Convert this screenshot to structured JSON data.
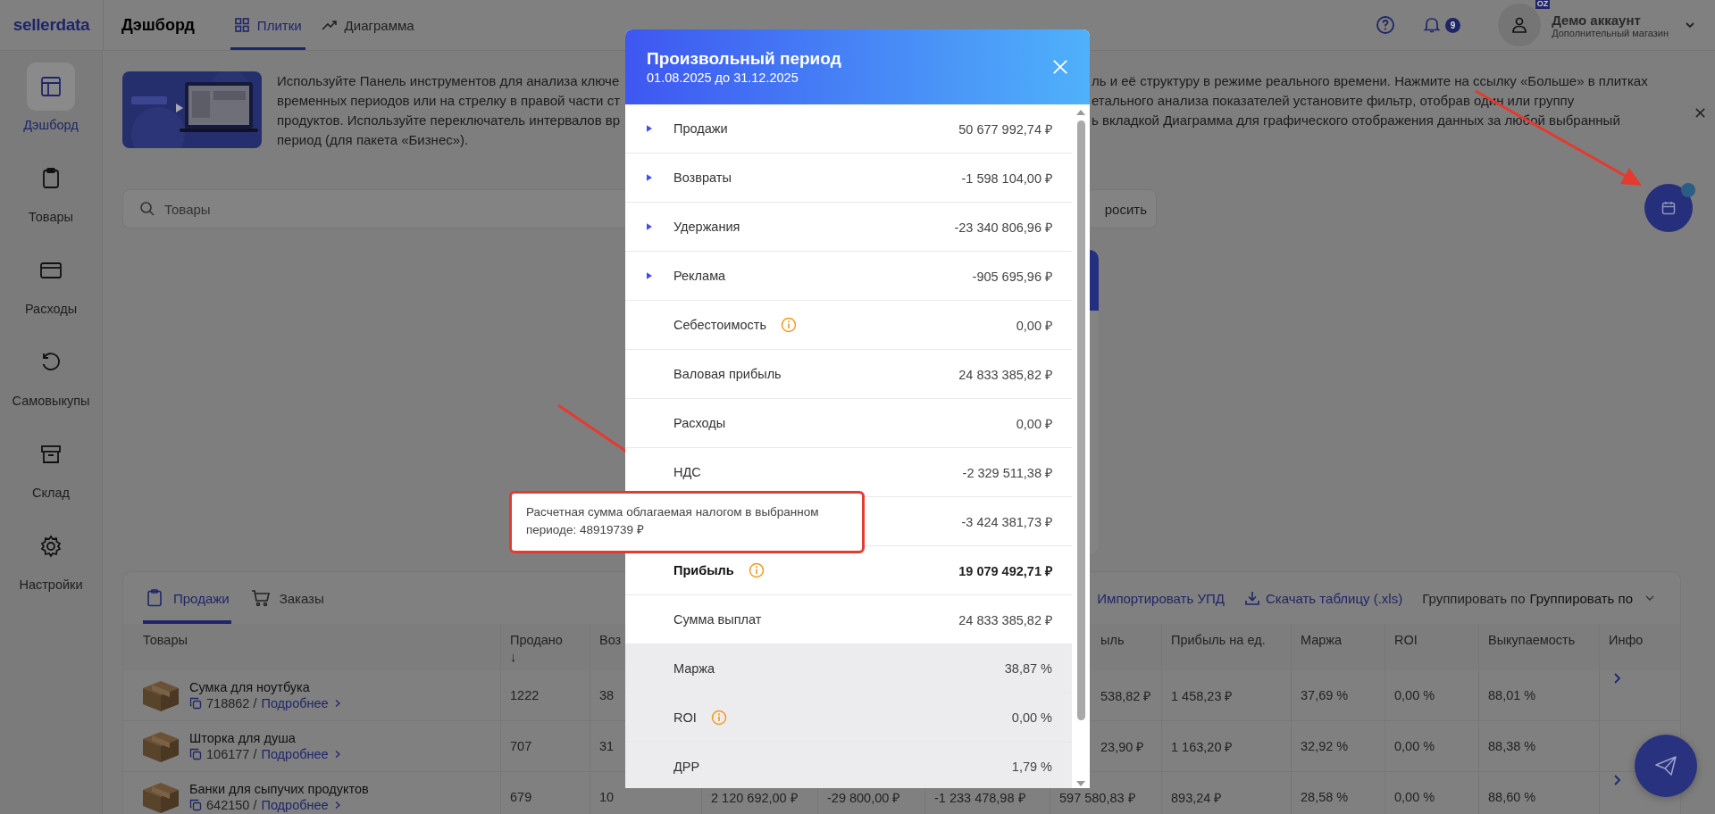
{
  "app": {
    "logo": "sellerdata"
  },
  "sidebar": {
    "items": [
      {
        "label": "Дэшборд",
        "selected": true
      },
      {
        "label": "Товары",
        "selected": false
      },
      {
        "label": "Расходы",
        "selected": false
      },
      {
        "label": "Самовыкупы",
        "selected": false
      },
      {
        "label": "Склад",
        "selected": false
      },
      {
        "label": "Настройки",
        "selected": false
      }
    ]
  },
  "header": {
    "title": "Дэшборд",
    "tabs": [
      {
        "label": "Плитки",
        "selected": true
      },
      {
        "label": "Диаграмма",
        "selected": false
      }
    ],
    "notifications": "9",
    "account": {
      "name": "Демо аккаунт",
      "store": "Дополнительный магазин",
      "badge": "OZ"
    }
  },
  "banner": {
    "text_left": [
      "Используйте Панель инструментов для анализа ключе",
      "временных периодов или на стрелку в правой части ст",
      "продуктов. Используйте переключатель интервалов вр",
      "период (для пакета «Бизнес»)."
    ],
    "text_right": [
      "ль и её структуру в режиме реального времени. Нажмите на ссылку «Больше» в плитках",
      "етального анализа показателей установите фильтр, отобрав один или группу",
      "ь вкладкой Диаграмма для графического отображения данных за любой выбранный"
    ]
  },
  "search": {
    "placeholder": "Товары",
    "reset": "росить"
  },
  "modal": {
    "title": "Произвольный период",
    "subtitle": "01.08.2025 до 31.12.2025",
    "rows": [
      {
        "kind": "expandable",
        "label": "Продажи",
        "value": "50 677 992,74 ₽",
        "info": false,
        "bold": false,
        "shaded": false
      },
      {
        "kind": "expandable",
        "label": "Возвраты",
        "value": "-1 598 104,00 ₽",
        "info": false,
        "bold": false,
        "shaded": false
      },
      {
        "kind": "expandable",
        "label": "Удержания",
        "value": "-23 340 806,96 ₽",
        "info": false,
        "bold": false,
        "shaded": false
      },
      {
        "kind": "expandable",
        "label": "Реклама",
        "value": "-905 695,96 ₽",
        "info": false,
        "bold": false,
        "shaded": false
      },
      {
        "kind": "plain",
        "label": "Себестоимость",
        "value": "0,00 ₽",
        "info": true,
        "bold": false,
        "shaded": false
      },
      {
        "kind": "plain",
        "label": "Валовая прибыль",
        "value": "24 833 385,82 ₽",
        "info": false,
        "bold": false,
        "shaded": false
      },
      {
        "kind": "plain",
        "label": "Расходы",
        "value": "0,00 ₽",
        "info": false,
        "bold": false,
        "shaded": false
      },
      {
        "kind": "plain",
        "label": "НДС",
        "value": "-2 329 511,38 ₽",
        "info": false,
        "bold": false,
        "shaded": false
      },
      {
        "kind": "plain",
        "value": "-3 424 381,73 ₽",
        "info": false,
        "bold": false,
        "shaded": false
      },
      {
        "kind": "plain",
        "label": "Прибыль",
        "value": "19 079 492,71 ₽",
        "info": true,
        "bold": true,
        "shaded": false
      },
      {
        "kind": "plain",
        "label": "Сумма выплат",
        "value": "24 833 385,82 ₽",
        "info": false,
        "bold": false,
        "shaded": false
      },
      {
        "kind": "plain",
        "label": "Маржа",
        "value": "38,87 %",
        "info": false,
        "bold": false,
        "shaded": true
      },
      {
        "kind": "plain",
        "label": "ROI",
        "value": "0,00 %",
        "info": true,
        "bold": false,
        "shaded": true
      },
      {
        "kind": "plain",
        "label": "ДРР",
        "value": "1,79 %",
        "info": false,
        "bold": false,
        "shaded": true
      }
    ]
  },
  "tooltip": {
    "text": "Расчетная сумма облагаемая налогом в выбранном периоде: 48919739 ₽"
  },
  "table_panel": {
    "tabs": [
      {
        "label": "Продажи",
        "selected": true
      },
      {
        "label": "Заказы",
        "selected": false
      }
    ],
    "actions": [
      "Импортировать УПД",
      "Скачать таблицу (.xls)"
    ],
    "group_by": {
      "label": "Группировать по",
      "value": "Группировать по"
    },
    "product_column": "Товары",
    "columns": [
      {
        "label": "Продано",
        "sort": "↓"
      },
      {
        "label": "Воз"
      },
      null,
      null,
      null,
      {
        "label": "ыль"
      },
      {
        "label": "Прибыль на ед."
      },
      {
        "label": "Маржа"
      },
      {
        "label": "ROI"
      },
      {
        "label": "Выкупаемость"
      }
    ],
    "info_column": "Инфо",
    "rows": [
      {
        "name": "Сумка для ноутбука",
        "sku": "718862 /",
        "link": "Подробнее",
        "chevron": true,
        "cells": [
          "1222",
          "38",
          null,
          null,
          null,
          "538,82 ₽",
          "1 458,23 ₽",
          "37,69 %",
          "0,00 %",
          "88,01 %"
        ]
      },
      {
        "name": "Шторка для душа",
        "sku": "106177 /",
        "link": "Подробнее",
        "chevron": false,
        "cells": [
          "707",
          "31",
          null,
          null,
          null,
          "23,90 ₽",
          "1 163,20 ₽",
          "32,92 %",
          "0,00 %",
          "88,38 %"
        ]
      },
      {
        "name": "Банки для сыпучих продуктов",
        "sku": "642150 /",
        "link": "Подробнее",
        "chevron": true,
        "cells": [
          "679",
          "10",
          "2 120 692,00 ₽",
          "-29 800,00 ₽",
          "-1 233 478,98 ₽",
          "597 580,83 ₽",
          "893,24 ₽",
          "28,58 %",
          "0,00 %",
          "88,60 %"
        ]
      }
    ]
  }
}
